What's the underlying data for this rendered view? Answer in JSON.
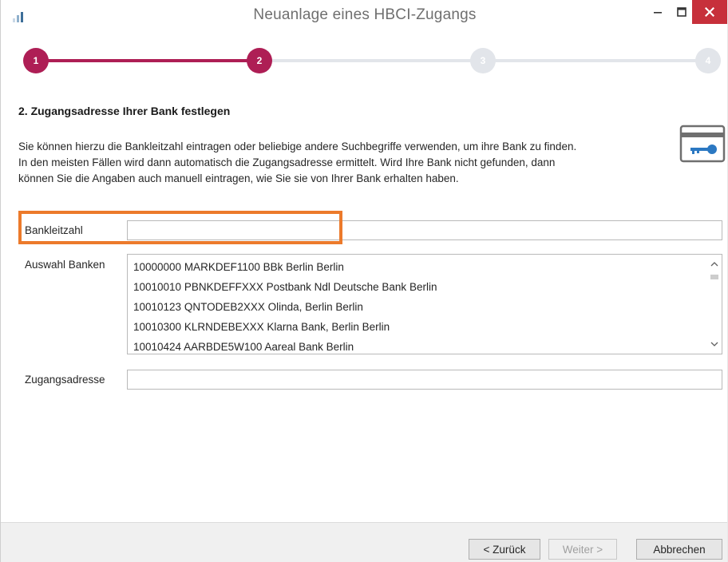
{
  "window": {
    "title": "Neuanlage eines HBCI-Zugangs",
    "colors": {
      "accent": "#ae1e55",
      "inactive_step": "#e2e5ea",
      "close_button": "#c7303b",
      "highlight": "#ec7a2b"
    }
  },
  "stepper": {
    "steps": [
      {
        "label": "1",
        "state": "active"
      },
      {
        "label": "2",
        "state": "active"
      },
      {
        "label": "3",
        "state": "inactive"
      },
      {
        "label": "4",
        "state": "inactive"
      }
    ]
  },
  "content": {
    "heading": "2. Zugangsadresse Ihrer Bank festlegen",
    "description_lines": [
      "Sie können hierzu die Bankleitzahl eintragen oder beliebige andere Suchbegriffe verwenden, um ihre Bank zu finden.",
      "In den meisten Fällen wird dann automatisch die Zugangsadresse ermittelt. Wird Ihre Bank nicht gefunden, dann",
      "können Sie die Angaben auch manuell eintragen, wie Sie sie von Ihrer Bank erhalten haben."
    ],
    "icon": "bank-card-key-icon"
  },
  "form": {
    "bankleitzahl_label": "Bankleitzahl",
    "bankleitzahl_value": "",
    "auswahl_label": "Auswahl Banken",
    "banks": [
      "10000000 MARKDEF1100 BBk Berlin Berlin",
      "10010010 PBNKDEFFXXX Postbank Ndl Deutsche Bank Berlin",
      "10010123 QNTODEB2XXX Olinda, Berlin Berlin",
      "10010300 KLRNDEBEXXX Klarna Bank, Berlin Berlin",
      "10010424 AARBDE5W100 Aareal Bank Berlin"
    ],
    "zugangsadresse_label": "Zugangsadresse",
    "zugangsadresse_value": ""
  },
  "footer": {
    "back_label": "< Zurück",
    "next_label": "Weiter >",
    "cancel_label": "Abbrechen"
  }
}
